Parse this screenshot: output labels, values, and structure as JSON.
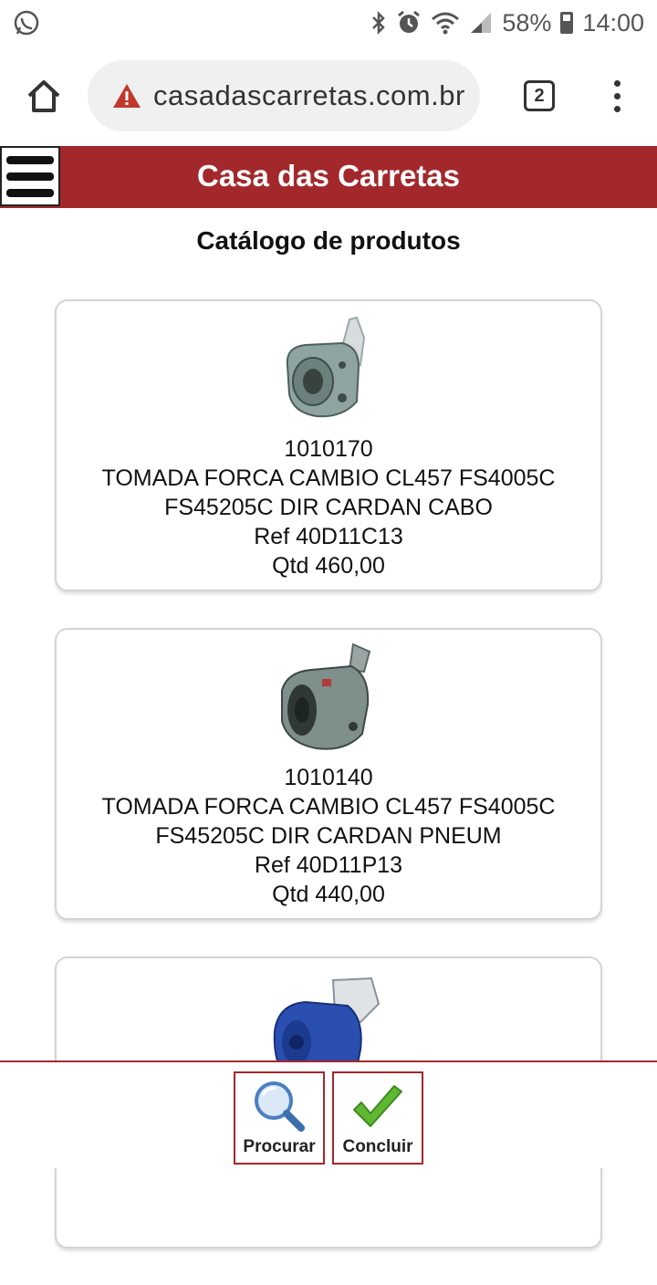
{
  "status": {
    "battery": "58%",
    "time": "14:00",
    "icons": [
      "whatsapp-icon",
      "bluetooth-icon",
      "alarm-icon",
      "wifi-icon",
      "signal-icon",
      "battery-icon"
    ]
  },
  "browser": {
    "url": "casadascarretas.com.br",
    "tab_count": "2",
    "warning_icon": "not-secure-warning-icon"
  },
  "header": {
    "title": "Casa das Carretas",
    "color": "#a3282c"
  },
  "page": {
    "heading": "Catálogo de produtos"
  },
  "products": [
    {
      "code": "1010170",
      "name_line1": "TOMADA FORCA CAMBIO CL457 FS4005C",
      "name_line2": "FS45205C DIR CARDAN CABO",
      "ref": "Ref 40D11C13",
      "qty": "Qtd 460,00"
    },
    {
      "code": "1010140",
      "name_line1": "TOMADA FORCA CAMBIO CL457 FS4005C",
      "name_line2": "FS45205C DIR CARDAN PNEUM",
      "ref": "Ref 40D11P13",
      "qty": "Qtd 440,00"
    },
    {
      "code": "",
      "name_line1": "",
      "name_line2": "",
      "ref": "",
      "qty": ""
    }
  ],
  "actions": {
    "search_label": "Procurar",
    "finish_label": "Concluir"
  }
}
